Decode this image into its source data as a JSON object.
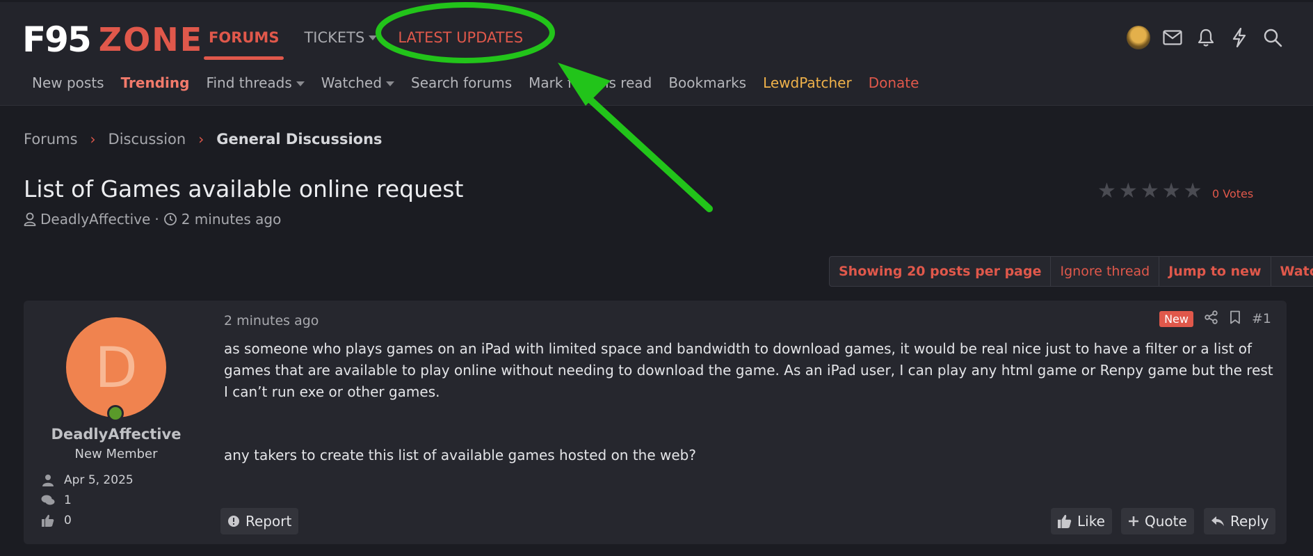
{
  "logo": {
    "part1": "F95",
    "part2": "ZONE"
  },
  "main_nav": [
    {
      "label": "FORUMS"
    },
    {
      "label": "TICKETS"
    },
    {
      "label": "LATEST UPDATES"
    }
  ],
  "sub_nav": [
    {
      "label": "New posts"
    },
    {
      "label": "Trending"
    },
    {
      "label": "Find threads"
    },
    {
      "label": "Watched"
    },
    {
      "label": "Search forums"
    },
    {
      "label": "Mark forums read"
    },
    {
      "label": "Bookmarks"
    },
    {
      "label": "LewdPatcher"
    },
    {
      "label": "Donate"
    }
  ],
  "breadcrumb": [
    "Forums",
    "Discussion",
    "General Discussions"
  ],
  "thread": {
    "title": "List of Games available online request",
    "author": "DeadlyAffective",
    "separator": "·",
    "time": "2 minutes ago",
    "rating_stars": 0,
    "votes": "0 Votes"
  },
  "thread_actions": [
    "Showing 20 posts per page",
    "Ignore thread",
    "Jump to new",
    "Watch"
  ],
  "post": {
    "avatar_letter": "D",
    "username": "DeadlyAffective",
    "user_title": "New Member",
    "joined": "Apr 5, 2025",
    "messages": "1",
    "reactions": "0",
    "time": "2 minutes ago",
    "badge": "New",
    "number": "#1",
    "body_p1": "as someone who plays games on an iPad with limited space and bandwidth to download games, it would be real nice just to have a filter or a list of games that are available to play online without needing to download the game. As an iPad user, I can play any html game or Renpy game but the rest I can’t run exe or other games.",
    "body_p2": "any takers to create this list of available games hosted on the web?",
    "report": "Report",
    "like": "Like",
    "quote": "Quote",
    "reply": "Reply"
  },
  "colors": {
    "accent": "#e0584b",
    "annotation": "#22c41a",
    "background": "#1b1c22",
    "panel": "#26272e"
  }
}
